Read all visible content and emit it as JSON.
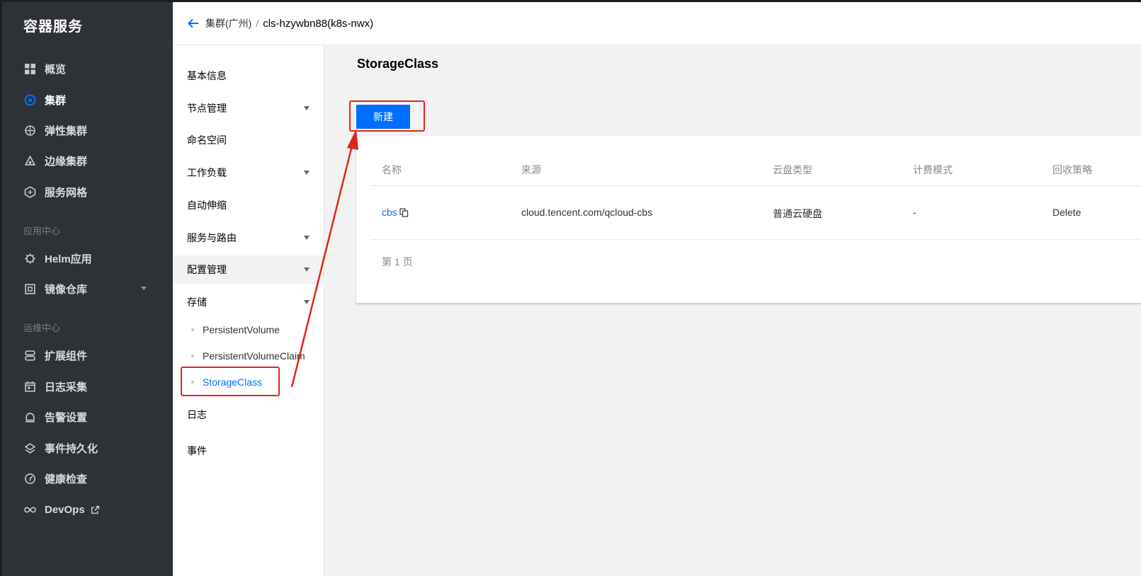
{
  "nav": {
    "title": "容器服务",
    "items": [
      {
        "label": "概览",
        "icon": "grid-icon"
      },
      {
        "label": "集群",
        "icon": "cluster-icon",
        "active": true
      },
      {
        "label": "弹性集群",
        "icon": "elastic-cluster-icon"
      },
      {
        "label": "边缘集群",
        "icon": "edge-cluster-icon"
      },
      {
        "label": "服务网格",
        "icon": "mesh-icon"
      }
    ],
    "section_app": "应用中心",
    "app_items": [
      {
        "label": "Helm应用",
        "icon": "helm-icon"
      },
      {
        "label": "镜像仓库",
        "icon": "image-repo-icon"
      }
    ],
    "section_ops": "运维中心",
    "ops_items": [
      {
        "label": "扩展组件",
        "icon": "addon-icon"
      },
      {
        "label": "日志采集",
        "icon": "calendar-icon"
      },
      {
        "label": "告警设置",
        "icon": "alarm-icon"
      },
      {
        "label": "事件持久化",
        "icon": "layers-icon"
      },
      {
        "label": "健康检查",
        "icon": "health-icon"
      },
      {
        "label": "DevOps",
        "icon": "infinity-icon"
      }
    ]
  },
  "header": {
    "crumb_parent": "集群(广州)",
    "separator": "/",
    "crumb_current": "cls-hzywbn88(k8s-nwx)"
  },
  "subnav": {
    "items": [
      "基本信息",
      "节点管理",
      "命名空间",
      "工作负载",
      "自动伸缩",
      "服务与路由",
      "配置管理",
      "存储"
    ],
    "children": [
      "PersistentVolume",
      "PersistentVolumeClaim",
      "StorageClass"
    ],
    "after": [
      "日志",
      "事件"
    ]
  },
  "main": {
    "title": "StorageClass",
    "create_label": "新建",
    "columns": [
      "名称",
      "来源",
      "云盘类型",
      "计费模式",
      "回收策略"
    ],
    "row": {
      "name": "cbs",
      "source": "cloud.tencent.com/qcloud-cbs",
      "disk_type": "普通云硬盘",
      "billing": "-",
      "reclaim": "Delete"
    },
    "pager": "第 1 页"
  },
  "colors": {
    "nav_bg": "#2e3135",
    "accent": "#006eff",
    "annotation": "#e2231a"
  }
}
